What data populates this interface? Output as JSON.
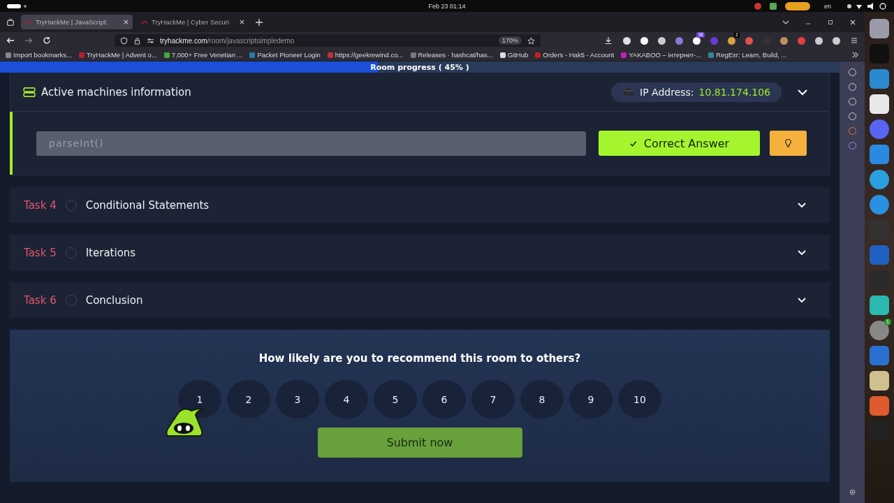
{
  "system_bar": {
    "clock": "Feb 23  01:14",
    "language": "en"
  },
  "tabs": [
    {
      "label": "TryHackMe | JavaScript:",
      "selected": true
    },
    {
      "label": "TryHackMe | Cyber Securi",
      "selected": false
    }
  ],
  "address_bar": {
    "domain": "tryhackme.com",
    "path": "/room/javascriptsimpledemo",
    "zoom": "170%"
  },
  "extension_badges": [
    "38",
    "2"
  ],
  "bookmarks": [
    "Import bookmarks...",
    "TryHackMe | Advent o...",
    "7,000+ Free Venetian ...",
    "Packet Pioneer Login",
    "https://geekrewind.co...",
    "Releases · hashcat/has...",
    "GitHub",
    "Orders - Hak5 - Account",
    "YAKABOO – інтернет-...",
    "RegExr: Learn, Build, ..."
  ],
  "progress": {
    "label": "Room progress ( 45% )",
    "level": 0.45
  },
  "machine": {
    "title": "Active machines information",
    "ip_label": "IP Address:",
    "ip": "10.81.174.106",
    "expanded": false
  },
  "answer": {
    "value": "parseInt()",
    "button": "Correct Answer",
    "correct": true
  },
  "tasks": [
    {
      "label": "Task 4",
      "title": "Conditional Statements",
      "completed": false,
      "expanded": false
    },
    {
      "label": "Task 5",
      "title": "Iterations",
      "completed": false,
      "expanded": false
    },
    {
      "label": "Task 6",
      "title": "Conclusion",
      "completed": false,
      "expanded": false
    }
  ],
  "feedback": {
    "question": "How likely are you to recommend this room to others?",
    "ratings": [
      {
        "label": "1",
        "selected": false
      },
      {
        "label": "2",
        "selected": false
      },
      {
        "label": "3",
        "selected": false
      },
      {
        "label": "4",
        "selected": false
      },
      {
        "label": "5",
        "selected": false
      },
      {
        "label": "6",
        "selected": false
      },
      {
        "label": "7",
        "selected": false
      },
      {
        "label": "8",
        "selected": false
      },
      {
        "label": "9",
        "selected": false
      },
      {
        "label": "10",
        "selected": false
      }
    ],
    "button": "Submit now"
  },
  "dock_badge": "1"
}
